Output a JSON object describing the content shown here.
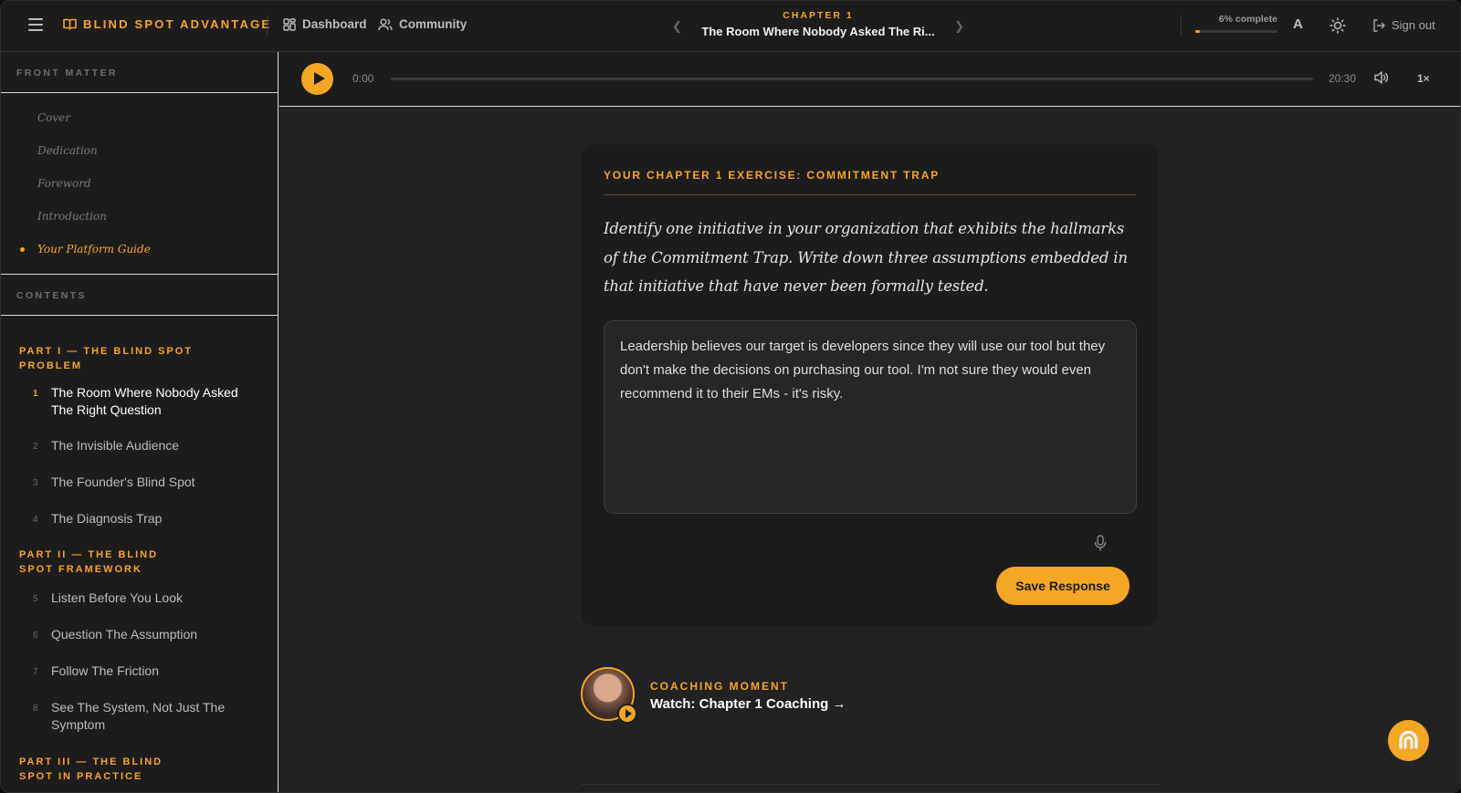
{
  "app": {
    "brand": "BLIND SPOT ADVANTAGE",
    "nav": [
      {
        "label": "Dashboard",
        "icon": "dashboard-grid-icon"
      },
      {
        "label": "Community",
        "icon": "users-icon"
      }
    ],
    "chapter_label": "CHAPTER 1",
    "chapter_title": "The Room Where Nobody Asked The Ri...",
    "progress_text": "6% complete",
    "progress_percent": 6,
    "font_toggle": "A",
    "sign_out": "Sign out",
    "accent_color": "#f5a623"
  },
  "sidebar": {
    "front_matter_heading": "FRONT MATTER",
    "front_matter": [
      {
        "label": "Cover"
      },
      {
        "label": "Dedication"
      },
      {
        "label": "Foreword"
      },
      {
        "label": "Introduction"
      },
      {
        "label": "Your Platform Guide"
      }
    ],
    "contents_heading": "CONTENTS",
    "parts": [
      {
        "title": "PART I — THE BLIND SPOT PROBLEM",
        "chapters": [
          {
            "num": "1",
            "title": "The Room Where Nobody Asked The Right Question"
          },
          {
            "num": "2",
            "title": "The Invisible Audience"
          },
          {
            "num": "3",
            "title": "The Founder's Blind Spot"
          },
          {
            "num": "4",
            "title": "The Diagnosis Trap"
          }
        ]
      },
      {
        "title": "PART II — THE BLIND SPOT FRAMEWORK",
        "chapters": [
          {
            "num": "5",
            "title": "Listen Before You Look"
          },
          {
            "num": "6",
            "title": "Question The Assumption"
          },
          {
            "num": "7",
            "title": "Follow The Friction"
          },
          {
            "num": "8",
            "title": "See The System, Not Just The Symptom"
          }
        ]
      },
      {
        "title": "PART III — THE BLIND SPOT IN PRACTICE",
        "chapters": []
      }
    ]
  },
  "player": {
    "current_time": "0:00",
    "duration": "20:30",
    "speed": "1×"
  },
  "exercise": {
    "title": "YOUR CHAPTER 1 EXERCISE: COMMITMENT TRAP",
    "prompt": "Identify one initiative in your organization that exhibits the hallmarks of the Commitment Trap. Write down three assumptions embedded in that initiative that have never been formally tested.",
    "response": "Leadership believes our target is developers since they will use our tool but they don't make the decisions on purchasing our tool. I'm not sure they would even recommend it to their EMs - it's risky.",
    "save_label": "Save Response"
  },
  "coaching": {
    "label": "COACHING MOMENT",
    "link": "Watch: Chapter 1 Coaching →"
  }
}
